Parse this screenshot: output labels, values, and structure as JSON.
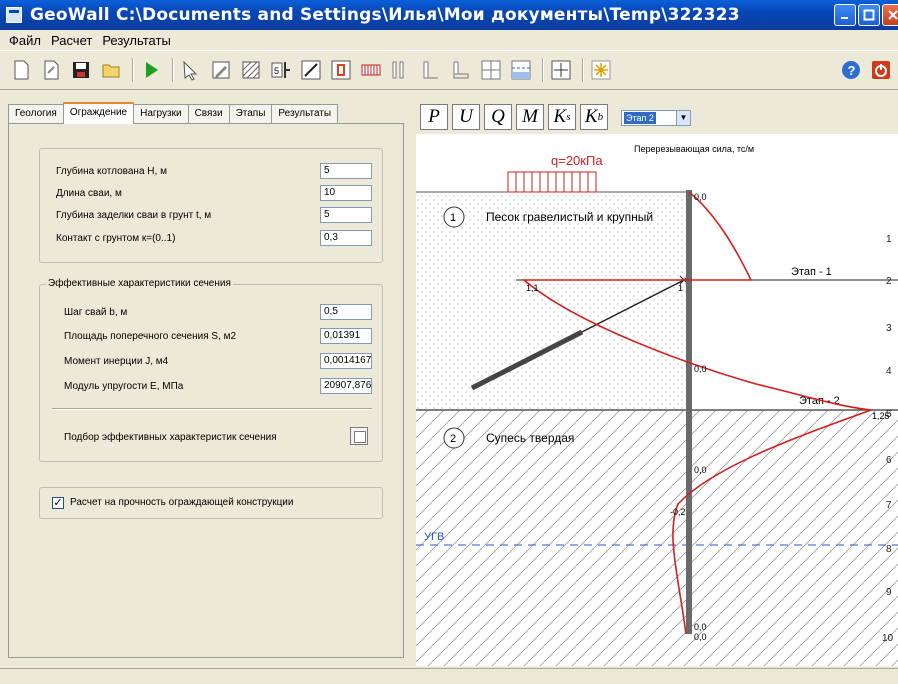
{
  "window": {
    "title": "GeoWall C:\\Documents and Settings\\Илья\\Мои документы\\Temp\\322323"
  },
  "menu": {
    "items": [
      "Файл",
      "Расчет",
      "Результаты"
    ]
  },
  "tabs": [
    "Геология",
    "Ограждение",
    "Нагрузки",
    "Связи",
    "Этапы",
    "Результаты"
  ],
  "params": {
    "pit_depth_label": "Глубина котлована H, м",
    "pit_depth": "5",
    "pile_length_label": "Длина сваи, м",
    "pile_length": "10",
    "embed_label": "Глубина заделки сваи в грунт t, м",
    "embed": "5",
    "contact_label": "Контакт с грунтом к=(0..1)",
    "contact": "0,3"
  },
  "section": {
    "title": "Эффективные характеристики сечения",
    "step_label": "Шаг свай b, м",
    "step": "0,5",
    "area_label": "Площадь поперечного сечения S, м2",
    "area": "0,01391",
    "inertia_label": "Момент инерции J, м4",
    "inertia": "0,0014167",
    "modulus_label": "Модуль упругости E, МПа",
    "modulus": "20907,876",
    "fit_label": "Подбор эффективных характеристик сечения"
  },
  "strength_check": {
    "label": "Расчет на прочность ограждающей конструкции",
    "checked": true
  },
  "diagram": {
    "buttons": [
      "P",
      "U",
      "Q",
      "M",
      "K",
      "K"
    ],
    "button_subs": [
      "",
      "",
      "",
      "",
      "s",
      "b"
    ],
    "stage_value": "Этап 2",
    "chart_title": "Перерезывающая сила, тс/м",
    "load_label": "q=20кПа",
    "soil1": "Песок гравелистый и крупный",
    "soil1_num": "1",
    "soil2": "Супесь твердая",
    "soil2_num": "2",
    "gw_label": "УГВ",
    "stage1": "Этап - 1",
    "stage2": "Этап - 2",
    "values": [
      "0,0",
      "1,1",
      "1",
      "0,0",
      "1,25",
      "0,0",
      "-0,2",
      "0,0",
      "0,0"
    ],
    "depth_ticks": [
      "1",
      "2",
      "3",
      "4",
      "5",
      "6",
      "7",
      "8",
      "9",
      "10"
    ]
  }
}
